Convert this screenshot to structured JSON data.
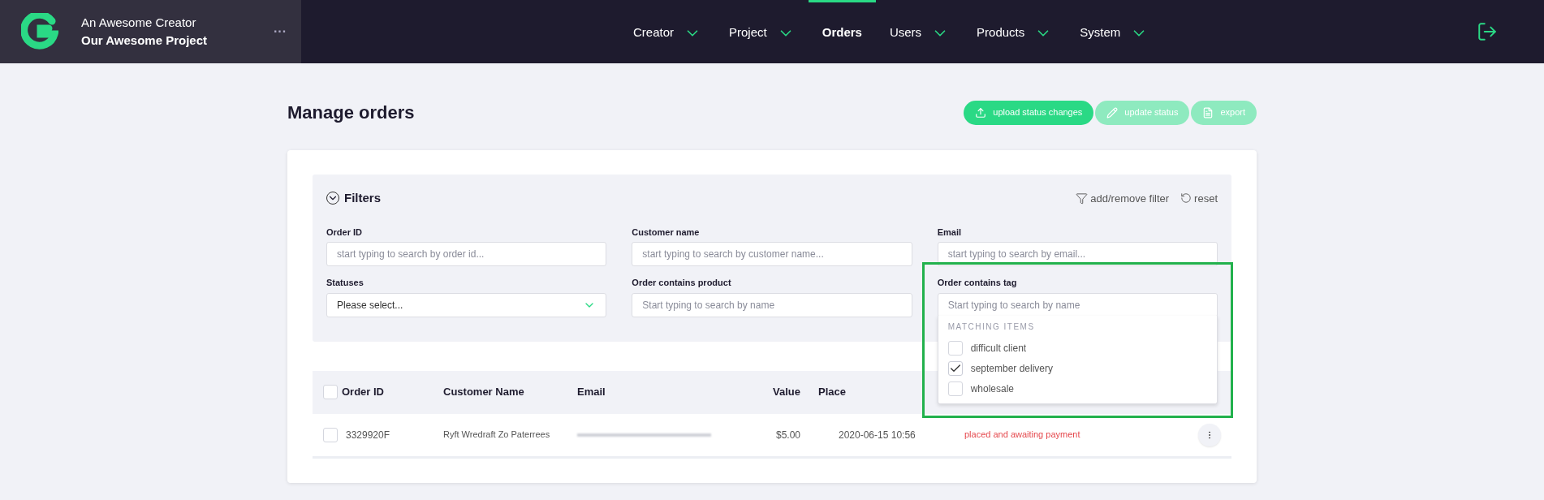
{
  "brand": {
    "creator": "An Awesome Creator",
    "project": "Our Awesome Project",
    "more": "···"
  },
  "nav": [
    {
      "label": "Creator",
      "selected": false,
      "dropdown": true
    },
    {
      "label": "Project",
      "selected": false,
      "dropdown": true
    },
    {
      "label": "Orders",
      "selected": true,
      "dropdown": false
    },
    {
      "label": "Users",
      "selected": false,
      "dropdown": true
    },
    {
      "label": "Products",
      "selected": false,
      "dropdown": true
    },
    {
      "label": "System",
      "selected": false,
      "dropdown": true
    }
  ],
  "page": {
    "title": "Manage orders"
  },
  "actions": [
    {
      "label": "upload status changes",
      "kind": "upload",
      "disabled": false
    },
    {
      "label": "update status",
      "kind": "edit",
      "disabled": true
    },
    {
      "label": "export",
      "kind": "file",
      "disabled": true
    }
  ],
  "filters": {
    "title": "Filters",
    "add_remove": "add/remove filter",
    "reset": "reset",
    "fields": [
      {
        "label": "Order ID",
        "placeholder": "start typing to search by order id...",
        "kind": "text"
      },
      {
        "label": "Customer name",
        "placeholder": "start typing to search by customer name...",
        "kind": "text"
      },
      {
        "label": "Email",
        "placeholder": "start typing to search by email...",
        "kind": "text"
      },
      {
        "label": "Statuses",
        "value": "Please select...",
        "kind": "select"
      },
      {
        "label": "Order contains product",
        "placeholder": "Start typing to search by name",
        "kind": "text"
      },
      {
        "label": "Order contains tag",
        "placeholder": "Start typing to search by name",
        "kind": "tags"
      }
    ]
  },
  "tag_dropdown": {
    "heading": "MATCHING ITEMS",
    "highlighted": true,
    "items": [
      {
        "label": "difficult client",
        "checked": false
      },
      {
        "label": "september delivery",
        "checked": true
      },
      {
        "label": "wholesale",
        "checked": false
      }
    ]
  },
  "table": {
    "select_all": false,
    "columns": [
      "Order ID",
      "Customer Name",
      "Email",
      "Value",
      "Place"
    ],
    "rows": [
      {
        "selected": false,
        "order_id": "3329920F",
        "customer": "Ryft Wredraft Zo Paterrees",
        "value": "$5.00",
        "placed": "2020-06-15 10:56",
        "status": "placed and awaiting payment",
        "color": "#e5484d"
      }
    ]
  }
}
